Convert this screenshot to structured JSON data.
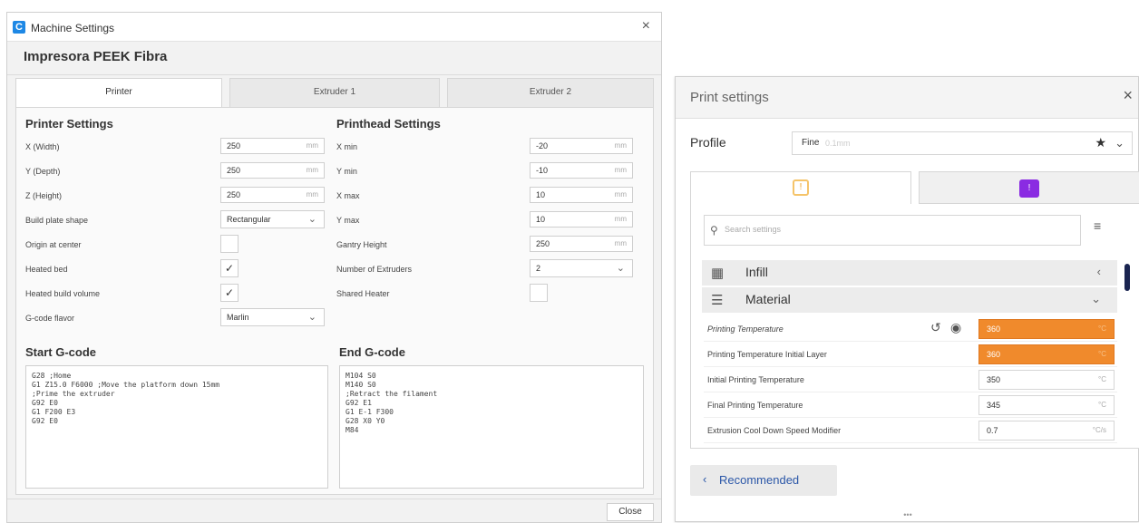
{
  "machine_settings": {
    "title": "Machine Settings",
    "close_glyph": "×",
    "printer_name": "Impresora PEEK Fibra",
    "tabs": [
      "Printer",
      "Extruder 1",
      "Extruder 2"
    ],
    "printer_settings": {
      "heading": "Printer Settings",
      "x_label": "X (Width)",
      "x_value": "250",
      "x_unit": "mm",
      "y_label": "Y (Depth)",
      "y_value": "250",
      "y_unit": "mm",
      "z_label": "Z (Height)",
      "z_value": "250",
      "z_unit": "mm",
      "plate_label": "Build plate shape",
      "plate_value": "Rectangular",
      "origin_label": "Origin at center",
      "origin_checked": false,
      "heated_bed_label": "Heated bed",
      "heated_bed_checked": true,
      "heated_vol_label": "Heated build volume",
      "heated_vol_checked": true,
      "flavor_label": "G-code flavor",
      "flavor_value": "Marlin"
    },
    "printhead_settings": {
      "heading": "Printhead Settings",
      "xmin_label": "X min",
      "xmin_value": "-20",
      "xmin_unit": "mm",
      "ymin_label": "Y min",
      "ymin_value": "-10",
      "ymin_unit": "mm",
      "xmax_label": "X max",
      "xmax_value": "10",
      "xmax_unit": "mm",
      "ymax_label": "Y max",
      "ymax_value": "10",
      "ymax_unit": "mm",
      "gantry_label": "Gantry Height",
      "gantry_value": "250",
      "gantry_unit": "mm",
      "extruders_label": "Number of Extruders",
      "extruders_value": "2",
      "shared_heater_label": "Shared Heater",
      "shared_heater_checked": false
    },
    "start_gcode": {
      "heading": "Start G-code",
      "text": "G28 ;Home\nG1 Z15.0 F6000 ;Move the platform down 15mm\n;Prime the extruder\nG92 E0\nG1 F200 E3\nG92 E0"
    },
    "end_gcode": {
      "heading": "End G-code",
      "text": "M104 S0\nM140 S0\n;Retract the filament\nG92 E1\nG1 E-1 F300\nG28 X0 Y0\nM84"
    },
    "close_button": "Close"
  },
  "print_settings": {
    "title": "Print settings",
    "close_glyph": "×",
    "profile_label": "Profile",
    "profile_value": "Fine",
    "profile_sub": "0.1mm",
    "recommended_tab_icon": "!",
    "custom_tab_icon": "!",
    "search_placeholder": "Search settings",
    "categories": [
      {
        "label": "Infill",
        "icon": "infill-icon",
        "expanded": false
      },
      {
        "label": "Material",
        "icon": "material-icon",
        "expanded": true
      }
    ],
    "settings": [
      {
        "label": "Printing Temperature",
        "value": "360",
        "unit": "°C",
        "highlighted": true
      },
      {
        "label": "Printing Temperature Initial Layer",
        "value": "360",
        "unit": "°C",
        "highlighted": true
      },
      {
        "label": "Initial Printing Temperature",
        "value": "350",
        "unit": "°C",
        "highlighted": false
      },
      {
        "label": "Final Printing Temperature",
        "value": "345",
        "unit": "°C",
        "highlighted": false
      },
      {
        "label": "Extrusion Cool Down Speed Modifier",
        "value": "0.7",
        "unit": "°C/s",
        "highlighted": false
      }
    ],
    "recommended_button": "Recommended",
    "resize_handle": "•••",
    "colors": {
      "highlight": "#f08a2c",
      "custom_accent": "#8a2be2",
      "link": "#2b57a8"
    }
  }
}
